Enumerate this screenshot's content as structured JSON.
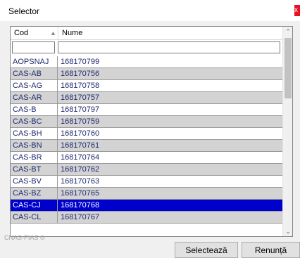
{
  "window": {
    "title": "Selector",
    "close_glyph": "x"
  },
  "grid": {
    "columns": [
      "Cod",
      "Nume"
    ],
    "filter_values": [
      "",
      ""
    ],
    "rows": [
      {
        "cod": "AOPSNAJ",
        "nume": "168170799"
      },
      {
        "cod": "CAS-AB",
        "nume": "168170756"
      },
      {
        "cod": "CAS-AG",
        "nume": "168170758"
      },
      {
        "cod": "CAS-AR",
        "nume": "168170757"
      },
      {
        "cod": "CAS-B",
        "nume": "168170797"
      },
      {
        "cod": "CAS-BC",
        "nume": "168170759"
      },
      {
        "cod": "CAS-BH",
        "nume": "168170760"
      },
      {
        "cod": "CAS-BN",
        "nume": "168170761"
      },
      {
        "cod": "CAS-BR",
        "nume": "168170764"
      },
      {
        "cod": "CAS-BT",
        "nume": "168170762"
      },
      {
        "cod": "CAS-BV",
        "nume": "168170763"
      },
      {
        "cod": "CAS-BZ",
        "nume": "168170765"
      },
      {
        "cod": "CAS-CJ",
        "nume": "168170768"
      },
      {
        "cod": "CAS-CL",
        "nume": "168170767"
      }
    ],
    "selected_index": 12
  },
  "footer": {
    "watermark": "CNAS-PIAS ®",
    "select_label": "Selectează",
    "cancel_label": "Renunță"
  },
  "icons": {
    "sort": "sort-up-icon",
    "scroll_up": "chevron-up-icon",
    "scroll_down": "chevron-down-icon"
  },
  "colors": {
    "selected_row": "#0000cd",
    "alt_row": "#d3d3d3",
    "close": "#e81123"
  }
}
